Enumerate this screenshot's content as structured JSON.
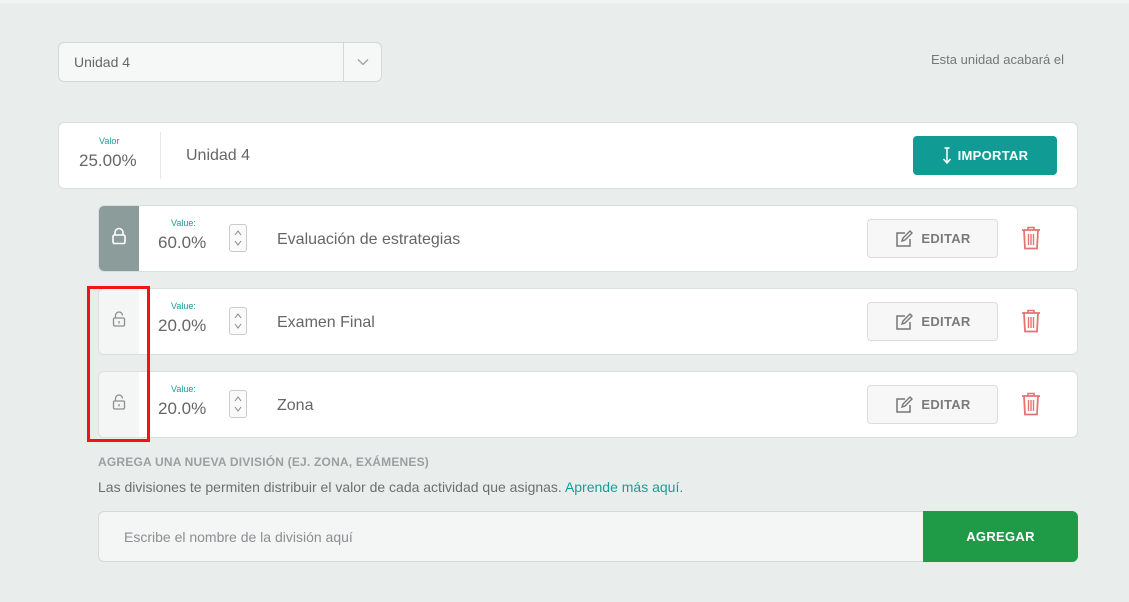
{
  "unit_select": {
    "value": "Unidad 4"
  },
  "end_note": "Esta unidad acabará el",
  "unit_card": {
    "value_label": "Valor",
    "value": "25.00%",
    "name": "Unidad 4",
    "import_label": "IMPORTAR"
  },
  "divisions": [
    {
      "value_label": "Value:",
      "value": "60.0%",
      "name": "Evaluación de estrategias",
      "locked": true,
      "edit_label": "EDITAR"
    },
    {
      "value_label": "Value:",
      "value": "20.0%",
      "name": "Examen Final",
      "locked": false,
      "edit_label": "EDITAR"
    },
    {
      "value_label": "Value:",
      "value": "20.0%",
      "name": "Zona",
      "locked": false,
      "edit_label": "EDITAR"
    }
  ],
  "new_division": {
    "title": "AGREGA UNA NUEVA DIVISIÓN (EJ. ZONA, EXÁMENES)",
    "description": "Las divisiones te permiten distribuir el valor de cada actividad que asignas.",
    "link_text": "Aprende más aquí.",
    "placeholder": "Escribe el nombre de la división aquí",
    "add_label": "AGREGAR"
  },
  "colors": {
    "accent": "#109c95",
    "add_green": "#1f9a47",
    "delete_red": "#e57373",
    "locked_gray": "#8b9c9b",
    "highlight_red": "#f01414"
  },
  "icons": {
    "select_caret": "chevron-down-icon",
    "import": "import-arrow-icon",
    "locked": "lock-closed-icon",
    "unlocked": "lock-open-icon",
    "edit": "pencil-square-icon",
    "delete": "trash-icon"
  }
}
